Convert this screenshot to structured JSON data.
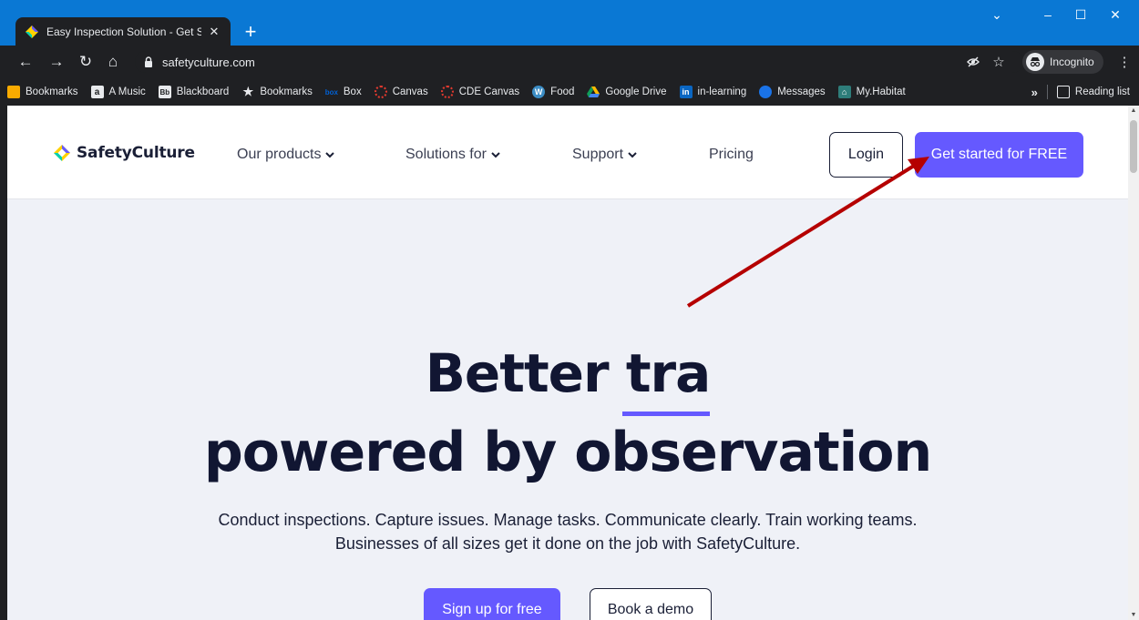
{
  "browser": {
    "tab_title": "Easy Inspection Solution - Get St",
    "url": "safetyculture.com",
    "incognito_label": "Incognito",
    "reading_list": "Reading list",
    "overflow": "»"
  },
  "bookmarks": [
    {
      "label": "Bookmarks",
      "icon": "folder-icon"
    },
    {
      "label": "A Music",
      "icon": "amazon-icon"
    },
    {
      "label": "Blackboard",
      "icon": "blackboard-icon"
    },
    {
      "label": "Bookmarks",
      "icon": "star-icon"
    },
    {
      "label": "Box",
      "icon": "box-icon"
    },
    {
      "label": "Canvas",
      "icon": "canvas-icon"
    },
    {
      "label": "CDE Canvas",
      "icon": "canvas-icon"
    },
    {
      "label": "Food",
      "icon": "wordpress-icon"
    },
    {
      "label": "Google Drive",
      "icon": "google-drive-icon"
    },
    {
      "label": "in-learning",
      "icon": "linkedin-icon"
    },
    {
      "label": "Messages",
      "icon": "messages-icon"
    },
    {
      "label": "My.Habitat",
      "icon": "habitat-icon"
    }
  ],
  "site": {
    "logo": "SafetyCulture",
    "nav": [
      "Our products",
      "Solutions for",
      "Support",
      "Pricing"
    ],
    "login": "Login",
    "get_started": "Get started for FREE"
  },
  "hero": {
    "line1": "Better tra",
    "line2": "powered by observation",
    "sub1": "Conduct inspections. Capture issues. Manage tasks. Communicate clearly. Train working teams.",
    "sub2": "Businesses of all sizes get it done on the job with SafetyCulture.",
    "signup": "Sign up for free",
    "demo": "Book a demo"
  },
  "colors": {
    "accent": "#6559ff",
    "title_bar": "#0a78d4",
    "annotation_arrow": "#b50000"
  }
}
